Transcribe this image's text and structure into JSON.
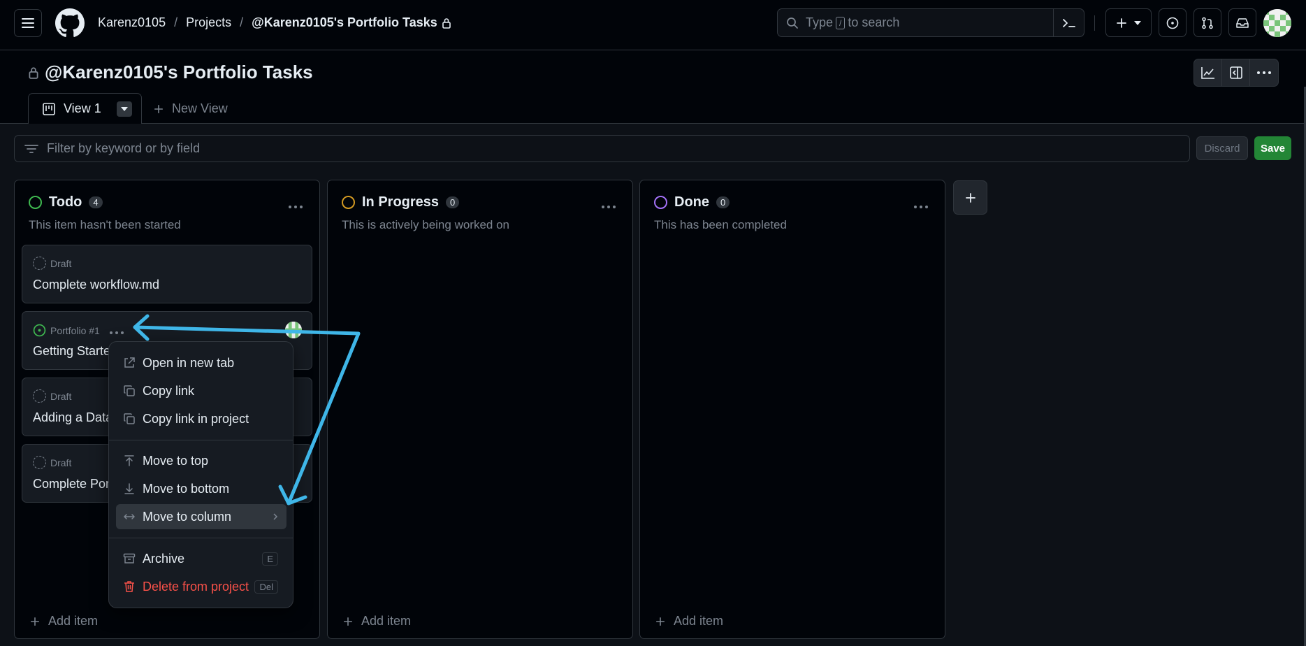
{
  "header": {
    "breadcrumbs": [
      "Karenz0105",
      "Projects",
      "@Karenz0105's Portfolio Tasks"
    ],
    "search": {
      "prefix": "Type",
      "key": "/",
      "suffix": "to search"
    }
  },
  "project": {
    "title": "@Karenz0105's Portfolio Tasks",
    "tabs": [
      {
        "label": "View 1"
      }
    ],
    "new_view_label": "New View"
  },
  "filter": {
    "placeholder": "Filter by keyword or by field",
    "discard_label": "Discard",
    "save_label": "Save"
  },
  "columns": [
    {
      "name": "Todo",
      "count": "4",
      "description": "This item hasn't been started",
      "color": "#3fb950",
      "cards": [
        {
          "meta": "Draft",
          "title": "Complete workflow.md"
        },
        {
          "meta": "Portfolio #1",
          "title": "Getting Starte"
        },
        {
          "meta": "Draft",
          "title": "Adding a Data"
        },
        {
          "meta": "Draft",
          "title": "Complete Por"
        }
      ]
    },
    {
      "name": "In Progress",
      "count": "0",
      "description": "This is actively being worked on",
      "color": "#d29922",
      "cards": []
    },
    {
      "name": "Done",
      "count": "0",
      "description": "This has been completed",
      "color": "#a371f7",
      "cards": []
    }
  ],
  "add_item_label": "Add item",
  "context_menu": {
    "items": [
      {
        "label": "Open in new tab",
        "icon": "external-link-icon"
      },
      {
        "label": "Copy link",
        "icon": "copy-icon"
      },
      {
        "label": "Copy link in project",
        "icon": "copy-icon"
      },
      {
        "label": "Move to top",
        "icon": "arrow-up-icon"
      },
      {
        "label": "Move to bottom",
        "icon": "arrow-down-icon"
      },
      {
        "label": "Move to column",
        "icon": "arrows-horizontal-icon"
      },
      {
        "label": "Archive",
        "icon": "archive-icon",
        "shortcut": "E"
      },
      {
        "label": "Delete from project",
        "icon": "trash-icon",
        "shortcut": "Del"
      }
    ]
  },
  "colors": {
    "accent_arrow": "#3fb6e8",
    "save_button": "#238636",
    "danger": "#f85149"
  }
}
